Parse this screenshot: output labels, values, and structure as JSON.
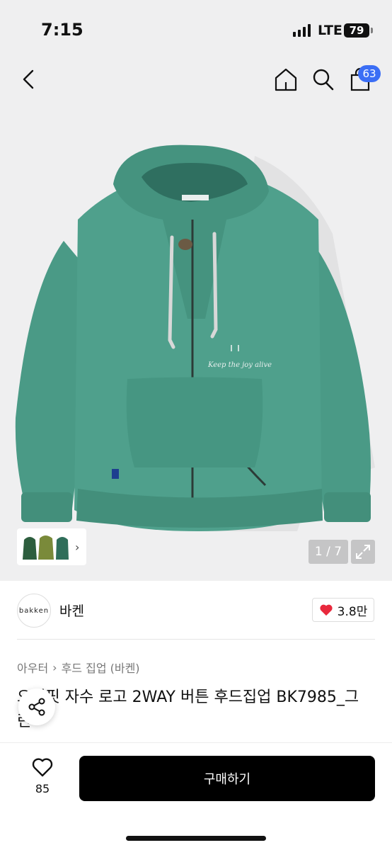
{
  "status_bar": {
    "time": "7:15",
    "network": "LTE",
    "battery": "79"
  },
  "nav": {
    "back_icon": "chevron-left-icon",
    "home_icon": "home-icon",
    "search_icon": "search-icon",
    "cart_icon": "shopping-bag-icon",
    "cart_badge": "63"
  },
  "gallery": {
    "counter": "1 / 7",
    "expand_icon": "expand-icon",
    "thumb_colors": [
      "#2d5e3e",
      "#7a8a3a",
      "#2f6e5a"
    ],
    "product_color": "#4a9a86"
  },
  "brand": {
    "logo_text": "bakken",
    "name": "바켄",
    "likes": "3.8만"
  },
  "product": {
    "breadcrumb": [
      "아우터",
      "후드 집업 (바켄)"
    ],
    "title": "오버핏 자수 로고 2WAY 버튼 후드집업 BK7985_그린",
    "embroidery": "Keep the joy alive"
  },
  "bottom_bar": {
    "wish_count": "85",
    "buy_label": "구매하기"
  },
  "colors": {
    "accent_badge": "#3b6ef5",
    "heart": "#e8283c",
    "buy_button": "#000000"
  }
}
